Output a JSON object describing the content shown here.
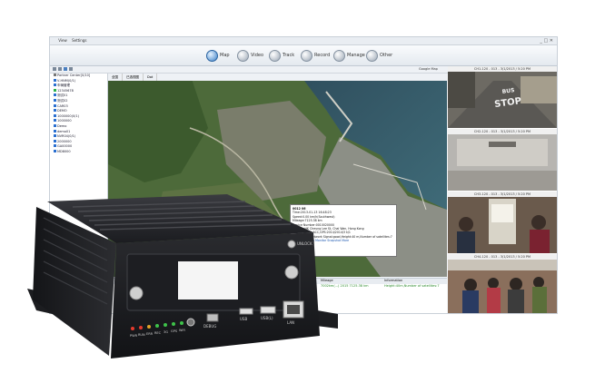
{
  "menu": {
    "items": [
      "",
      "View",
      "Settings"
    ],
    "window_controls": "_ □ ✕"
  },
  "toolbar": {
    "items": [
      {
        "label": "Map",
        "active": true
      },
      {
        "label": "Video",
        "active": false
      },
      {
        "label": "Track",
        "active": false
      },
      {
        "label": "Record",
        "active": false
      },
      {
        "label": "Manage",
        "active": false
      },
      {
        "label": "Other",
        "active": false
      }
    ],
    "map_provider": "Google Map"
  },
  "tree": {
    "root": "Partner Center[0/10]",
    "items": [
      "V-HNM(0/1)",
      "车辆管理",
      "12345678",
      "测试01",
      "测试02",
      "CAR03",
      "DEMO",
      "1000000(0/1)",
      "1000000",
      "Demo",
      "demo01",
      "NVR04(0/1)",
      "2000000",
      "GA00000",
      "MD8000"
    ]
  },
  "map": {
    "tabs": [
      "全国",
      "已选视图",
      "Dot"
    ],
    "popup": {
      "title": "0012 06",
      "time": "Time:2013-01-13 16:48:23",
      "speed": "Speed:0.00 km/h(Southwest)",
      "mileage": "Mileage:7125.38 km",
      "device": "Device Number:0010020000",
      "position": "Position:HK Cheung Lee St, Chai Wan, Hong Kong",
      "status": "Status:Online,ACC,GPS:2014/2014/3 k/1",
      "status2": "(Video:exit),Network Signal:good,Height:40 m,Number of satellites:7",
      "links": "Video  Intercom  Monitor  Snapshot  More"
    }
  },
  "grid": {
    "headers": [
      "Mileage",
      "Information"
    ],
    "row": [
      "7002km(...) 2015 7125.38 km",
      "Height:40m,Number of satellites:7"
    ]
  },
  "videos": {
    "labels": [
      "CH1-120 - 013 - 3/1/2013 / 5:20 PM",
      "CH2-120 - 013 - 3/1/2013 / 5:20 PM",
      "CH3-120 - 013 - 3/1/2013 / 5:20 PM",
      "CH4-120 - 013 - 3/1/2013 / 5:20 PM"
    ],
    "road_text": "BUS STOP"
  },
  "device": {
    "labels": [
      "PWR",
      "RUN",
      "ERR",
      "REC",
      "3G",
      "GPS",
      "WiFi"
    ],
    "port_labels": [
      "USB",
      "USB(L)",
      "LAN",
      "DEBUG"
    ],
    "lock": "UNLOCK"
  },
  "colors": {
    "accent": "#3b7fc6",
    "status_green": "#2a8a2a",
    "device_body": "#1c1d20"
  }
}
